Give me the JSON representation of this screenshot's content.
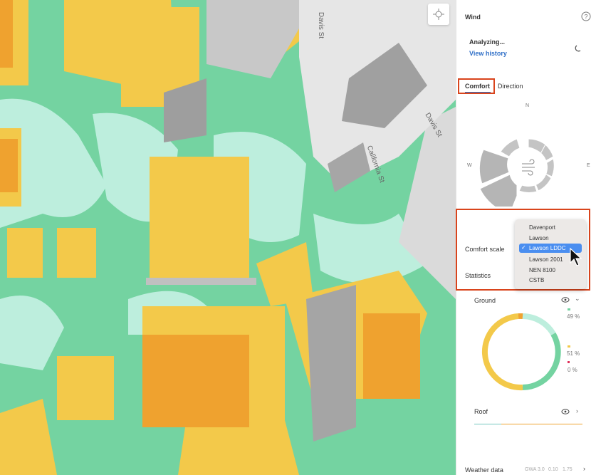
{
  "map": {
    "streets": [
      "Davis St",
      "Davis St",
      "California St"
    ],
    "locate_button_icon": "crosshair-icon"
  },
  "panel": {
    "title": "Wind",
    "help_icon": "question-circle-icon",
    "status": "Analyzing...",
    "view_history": "View history",
    "tabs": [
      {
        "label": "Comfort",
        "active": true
      },
      {
        "label": "Direction",
        "active": false
      }
    ],
    "compass": {
      "n": "N",
      "w": "W",
      "e": "E"
    },
    "comfort_scale_label": "Comfort scale",
    "statistics_label": "Statistics",
    "comfort_scale_options": [
      "Davenport",
      "Lawson",
      "Lawson LDDC",
      "Lawson 2001",
      "NEN 8100",
      "CSTB"
    ],
    "comfort_scale_selected": "Lawson LDDC",
    "ground": {
      "label": "Ground",
      "legend": [
        {
          "color": "#74d3a1",
          "value": "49 %"
        },
        {
          "color": "#f3c94a",
          "value": "51 %"
        },
        {
          "color": "#e0305a",
          "value": "0 %"
        }
      ]
    },
    "roof": {
      "label": "Roof",
      "bar_fraction_green": 0.25
    },
    "weather": {
      "label": "Weather data",
      "values": [
        "GWA 3.0",
        "0.10",
        "1.75"
      ]
    }
  },
  "colors": {
    "accent": "#2f6fc7",
    "highlight": "#d9441c",
    "green": "#74d3a1",
    "mint": "#bdeedd",
    "yellow": "#f3c94a",
    "orange": "#efa22f"
  }
}
